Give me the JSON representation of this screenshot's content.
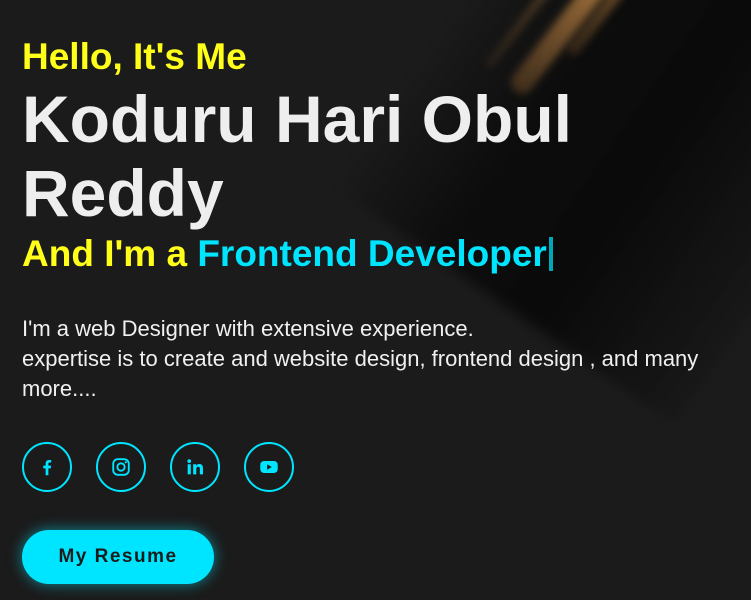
{
  "hero": {
    "greeting": "Hello, It's Me",
    "name": "Koduru Hari Obul Reddy",
    "role_prefix": "And I'm a",
    "role_word": "Frontend Developer",
    "bio_line1": "I'm a web Designer with extensive experience.",
    "bio_line2": "expertise is to create and website design, frontend design , and many more....",
    "resume_button": "My Resume"
  },
  "socials": [
    {
      "name": "facebook",
      "icon": "facebook-icon"
    },
    {
      "name": "instagram",
      "icon": "instagram-icon"
    },
    {
      "name": "linkedin",
      "icon": "linkedin-icon"
    },
    {
      "name": "youtube",
      "icon": "youtube-icon"
    }
  ],
  "colors": {
    "background": "#1b1b1b",
    "accent_yellow": "#ffff1a",
    "accent_cyan": "#00e5ff",
    "text_light": "#eeeeee"
  }
}
